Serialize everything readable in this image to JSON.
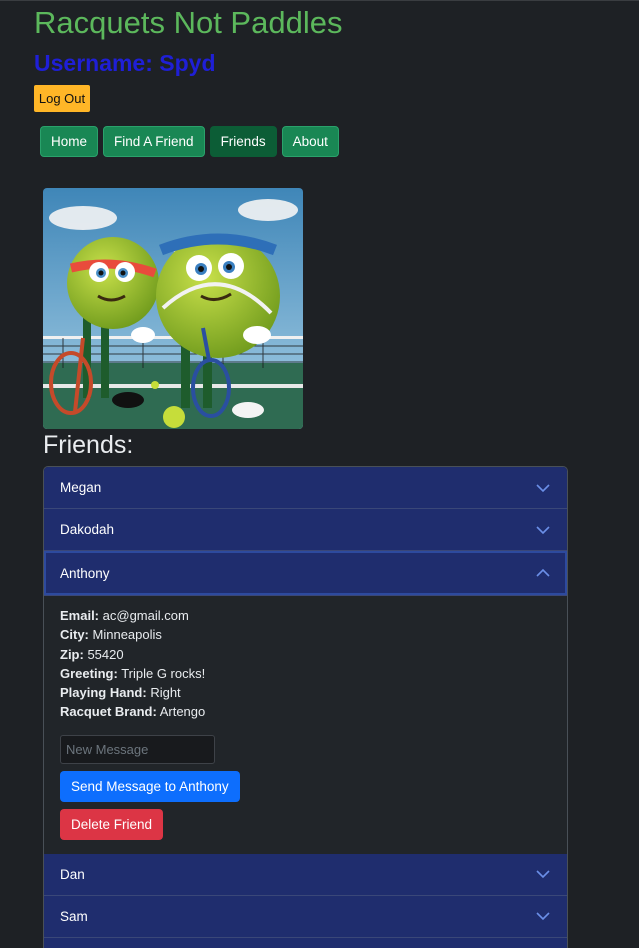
{
  "app": {
    "title": "Racquets Not Paddles",
    "username_label": "Username: Spyd",
    "logout_label": "Log Out"
  },
  "nav": {
    "items": [
      {
        "label": "Home",
        "active": false
      },
      {
        "label": "Find A Friend",
        "active": false
      },
      {
        "label": "Friends",
        "active": true
      },
      {
        "label": "About",
        "active": false
      }
    ]
  },
  "hero": {
    "icon": "tennis-ball-characters-image"
  },
  "friends": {
    "heading": "Friends:",
    "list": [
      {
        "name": "Megan",
        "expanded": false
      },
      {
        "name": "Dakodah",
        "expanded": false
      },
      {
        "name": "Anthony",
        "expanded": true
      },
      {
        "name": "Dan",
        "expanded": false
      },
      {
        "name": "Sam",
        "expanded": false
      }
    ],
    "expanded_detail": {
      "fields": [
        {
          "label": "Email:",
          "value": "ac@gmail.com"
        },
        {
          "label": "City:",
          "value": "Minneapolis"
        },
        {
          "label": "Zip:",
          "value": "55420"
        },
        {
          "label": "Greeting:",
          "value": "Triple G rocks!"
        },
        {
          "label": "Playing Hand:",
          "value": "Right"
        },
        {
          "label": "Racquet Brand:",
          "value": "Artengo"
        }
      ],
      "message_placeholder": "New Message",
      "send_label": "Send Message to Anthony",
      "delete_label": "Delete Friend"
    }
  },
  "colors": {
    "background": "#1e2125",
    "title": "#5cb85c",
    "username": "#1f1fd6",
    "logout": "#ffb627",
    "nav": "#198754",
    "nav_active": "#0c5d36",
    "accordion_header": "#1f2d6e",
    "primary": "#0d6efd",
    "danger": "#dc3545"
  }
}
